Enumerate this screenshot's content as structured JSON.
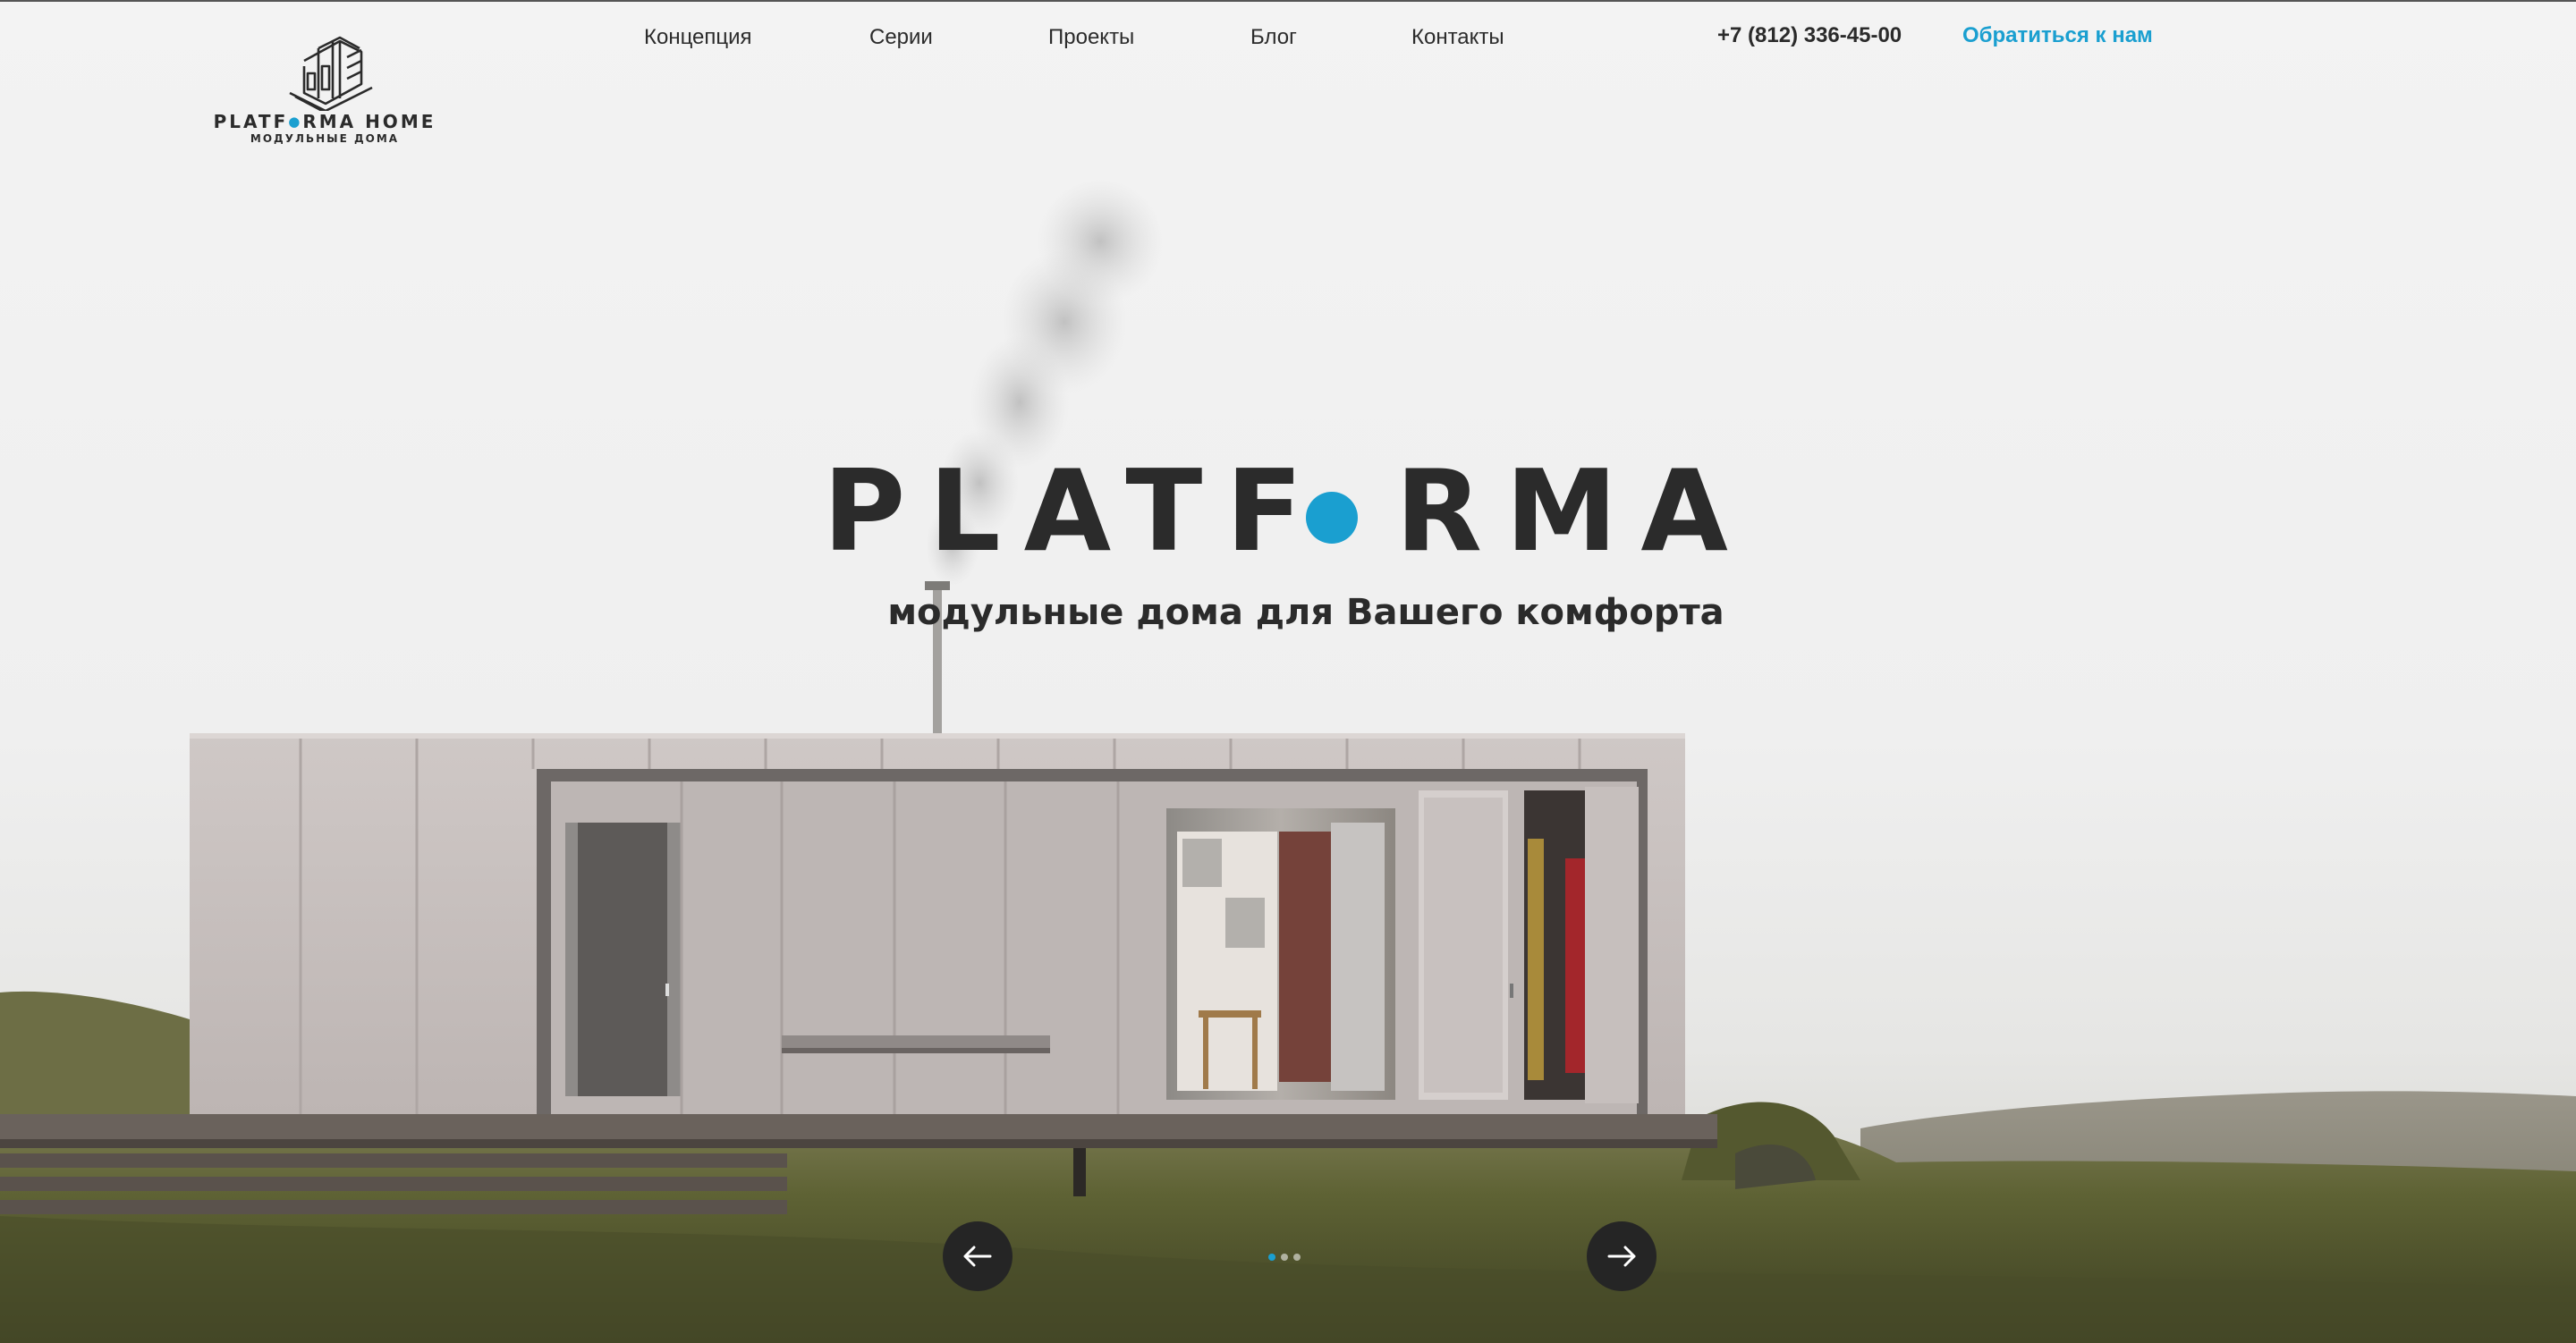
{
  "header": {
    "logo": {
      "title_left": "PLATF",
      "title_dot": "●",
      "title_right": "RMA HOME",
      "subtitle": "МОДУЛЬНЫЕ ДОМА"
    },
    "nav": [
      {
        "label": "Концепция"
      },
      {
        "label": "Серии"
      },
      {
        "label": "Проекты"
      },
      {
        "label": "Блог"
      },
      {
        "label": "Контакты"
      }
    ],
    "phone": "+7 (812) 336-45-00",
    "cta_label": "Обратиться к нам"
  },
  "hero": {
    "brand_left": "PLATF",
    "brand_right": "RMA",
    "tagline": "модульные дома для Вашего комфорта"
  },
  "slider": {
    "prev_icon": "arrow-left-icon",
    "next_icon": "arrow-right-icon",
    "slide_count": 3,
    "active_slide": 1
  },
  "colors": {
    "accent": "#1a9fd0",
    "text": "#2b2b2b",
    "arrow_bg": "#252525"
  }
}
